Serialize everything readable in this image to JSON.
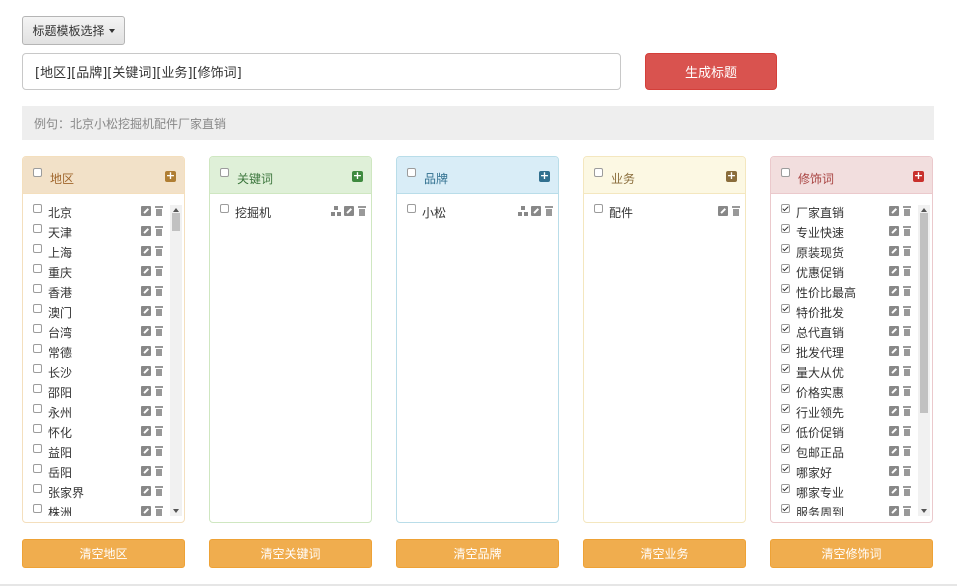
{
  "toolbar": {
    "template_select_label": "标题模板选择",
    "generate_label": "生成标题"
  },
  "pattern": {
    "value": "[地区][品牌][关键词][业务][修饰词]"
  },
  "example": {
    "text": "例句：北京小松挖掘机配件厂家直销"
  },
  "panels": [
    {
      "key": "region",
      "title": "地区",
      "clear_label": "清空地区",
      "colors": {
        "border": "#f4dfbd",
        "head_bg": "#f2e1c8",
        "title": "#a0662c",
        "plus": "#b07e33"
      },
      "items": [
        {
          "label": "北京",
          "checked": false
        },
        {
          "label": "天津",
          "checked": false
        },
        {
          "label": "上海",
          "checked": false
        },
        {
          "label": "重庆",
          "checked": false
        },
        {
          "label": "香港",
          "checked": false
        },
        {
          "label": "澳门",
          "checked": false
        },
        {
          "label": "台湾",
          "checked": false
        },
        {
          "label": "常德",
          "checked": false
        },
        {
          "label": "长沙",
          "checked": false
        },
        {
          "label": "邵阳",
          "checked": false
        },
        {
          "label": "永州",
          "checked": false
        },
        {
          "label": "怀化",
          "checked": false
        },
        {
          "label": "益阳",
          "checked": false
        },
        {
          "label": "岳阳",
          "checked": false
        },
        {
          "label": "张家界",
          "checked": false
        },
        {
          "label": "株洲",
          "checked": false
        }
      ],
      "has_tree": false,
      "scrollbar": true
    },
    {
      "key": "keyword",
      "title": "关键词",
      "clear_label": "清空关键词",
      "colors": {
        "border": "#cfe7c1",
        "head_bg": "#dff0d8",
        "title": "#3c763d",
        "plus": "#3f8a3f"
      },
      "items": [
        {
          "label": "挖掘机",
          "checked": false
        }
      ],
      "has_tree": true,
      "scrollbar": false
    },
    {
      "key": "brand",
      "title": "品牌",
      "clear_label": "清空品牌",
      "colors": {
        "border": "#b9dde9",
        "head_bg": "#d9edf7",
        "title": "#31708f",
        "plus": "#31708f"
      },
      "items": [
        {
          "label": "小松",
          "checked": false
        }
      ],
      "has_tree": true,
      "scrollbar": false
    },
    {
      "key": "business",
      "title": "业务",
      "clear_label": "清空业务",
      "colors": {
        "border": "#f4e7bf",
        "head_bg": "#fcf8e3",
        "title": "#8a6d3b",
        "plus": "#8a6d3b"
      },
      "items": [
        {
          "label": "配件",
          "checked": false
        }
      ],
      "has_tree": false,
      "scrollbar": false
    },
    {
      "key": "modifier",
      "title": "修饰词",
      "clear_label": "清空修饰词",
      "colors": {
        "border": "#ebc9cc",
        "head_bg": "#f2dede",
        "title": "#a94442",
        "plus": "#c9302c"
      },
      "items": [
        {
          "label": "厂家直销",
          "checked": true
        },
        {
          "label": "专业快速",
          "checked": true
        },
        {
          "label": "原装现货",
          "checked": true
        },
        {
          "label": "优惠促销",
          "checked": true
        },
        {
          "label": "性价比最高",
          "checked": true
        },
        {
          "label": "特价批发",
          "checked": true
        },
        {
          "label": "总代直销",
          "checked": true
        },
        {
          "label": "批发代理",
          "checked": true
        },
        {
          "label": "量大从优",
          "checked": true
        },
        {
          "label": "价格实惠",
          "checked": true
        },
        {
          "label": "行业领先",
          "checked": true
        },
        {
          "label": "低价促销",
          "checked": true
        },
        {
          "label": "包邮正品",
          "checked": true
        },
        {
          "label": "哪家好",
          "checked": true
        },
        {
          "label": "哪家专业",
          "checked": true
        },
        {
          "label": "服务周到",
          "checked": true
        }
      ],
      "has_tree": false,
      "scrollbar": true
    }
  ]
}
